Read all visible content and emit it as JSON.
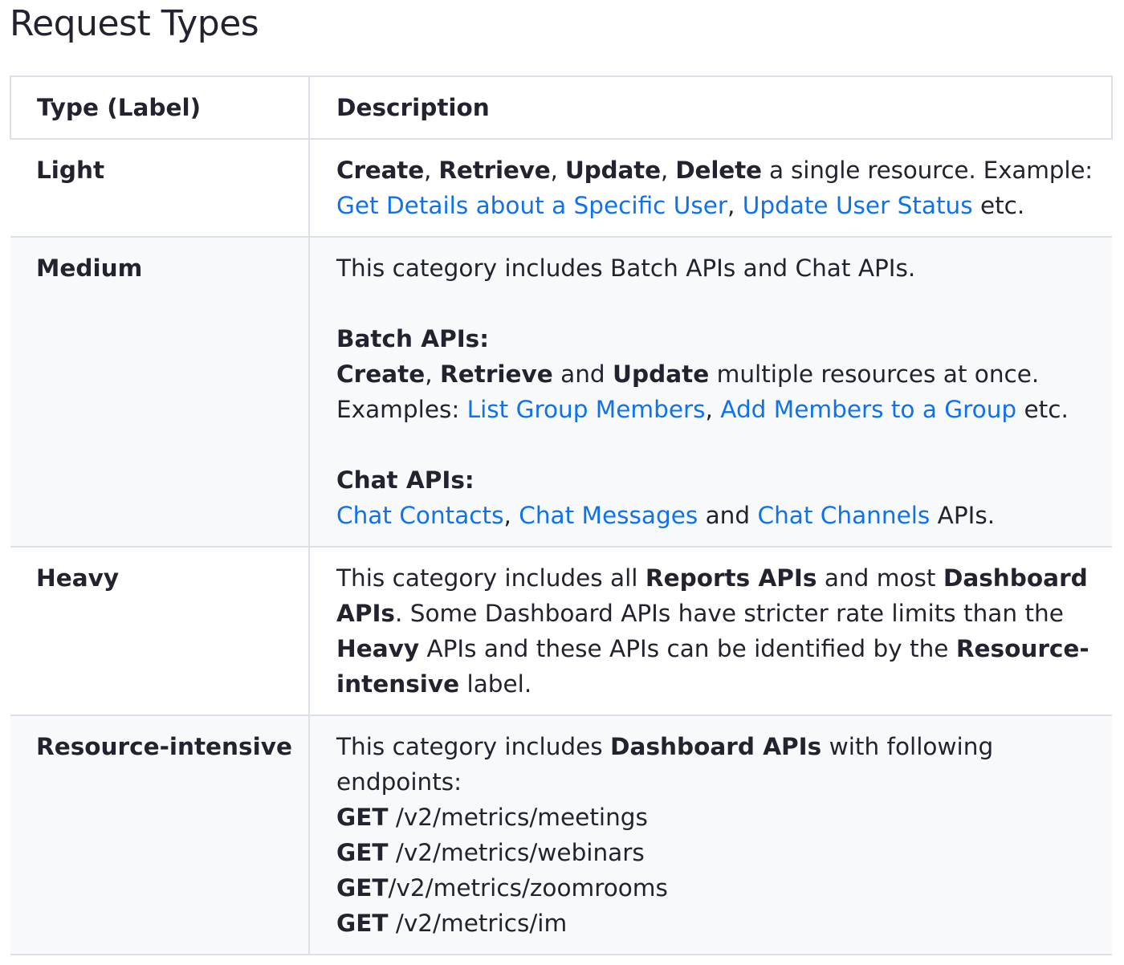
{
  "page": {
    "title": "Request Types"
  },
  "table": {
    "headers": {
      "type": "Type (Label)",
      "description": "Description"
    },
    "rows": {
      "light": {
        "type": "Light",
        "ops": [
          "Create",
          "Retrieve",
          "Update",
          "Delete"
        ],
        "sep": ", ",
        "text_after_ops": " a single resource. Example:",
        "links": [
          "Get Details about a Specific User",
          "Update User Status"
        ],
        "etc": " etc."
      },
      "medium": {
        "type": "Medium",
        "intro": "This category includes Batch APIs and Chat APIs.",
        "batch": {
          "heading": "Batch APIs:",
          "ops": [
            "Create",
            "Retrieve",
            "Update"
          ],
          "and": " and ",
          "text_after_ops": " multiple resources at once.",
          "examples_label": "Examples: ",
          "links": [
            "List Group Members",
            "Add Members to a Group"
          ],
          "etc": " etc."
        },
        "chat": {
          "heading": "Chat APIs:",
          "links": [
            "Chat Contacts",
            "Chat Messages",
            "Chat Channels"
          ],
          "and": " and ",
          "suffix": " APIs."
        }
      },
      "heavy": {
        "type": "Heavy",
        "t1": "This category includes all ",
        "b1": "Reports APIs",
        "t2": " and most ",
        "b2": "Dashboard APIs",
        "t3": ". Some Dashboard APIs have stricter rate limits than the ",
        "b3": "Heavy",
        "t4": " APIs and these APIs can be identified by the ",
        "b4": "Resource-intensive",
        "t5": " label."
      },
      "resource_intensive": {
        "type": "Resource-intensive",
        "t1": "This category includes ",
        "b1": "Dashboard APIs",
        "t2": " with following endpoints:",
        "endpoints": [
          {
            "method": "GET",
            "path": " /v2/metrics/meetings"
          },
          {
            "method": "GET",
            "path": " /v2/metrics/webinars"
          },
          {
            "method": "GET",
            "path": "/v2/metrics/zoomrooms"
          },
          {
            "method": "GET",
            "path": " /v2/metrics/im"
          }
        ]
      }
    }
  }
}
